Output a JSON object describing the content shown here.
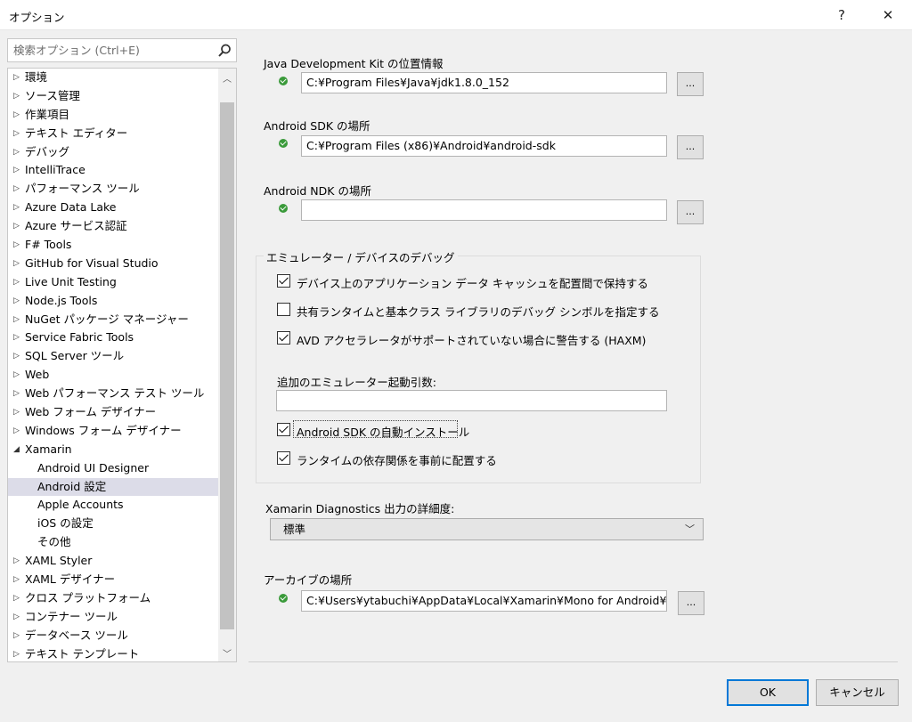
{
  "window": {
    "title": "オプション",
    "help_label": "?",
    "close_label": "✕"
  },
  "search": {
    "placeholder": "検索オプション (Ctrl+E)"
  },
  "tree": {
    "items": [
      {
        "label": "環境",
        "level": 0,
        "expanded": false
      },
      {
        "label": "ソース管理",
        "level": 0,
        "expanded": false
      },
      {
        "label": "作業項目",
        "level": 0,
        "expanded": false
      },
      {
        "label": "テキスト エディター",
        "level": 0,
        "expanded": false
      },
      {
        "label": "デバッグ",
        "level": 0,
        "expanded": false
      },
      {
        "label": "IntelliTrace",
        "level": 0,
        "expanded": false
      },
      {
        "label": "パフォーマンス ツール",
        "level": 0,
        "expanded": false
      },
      {
        "label": "Azure Data Lake",
        "level": 0,
        "expanded": false
      },
      {
        "label": "Azure サービス認証",
        "level": 0,
        "expanded": false
      },
      {
        "label": "F# Tools",
        "level": 0,
        "expanded": false
      },
      {
        "label": "GitHub for Visual Studio",
        "level": 0,
        "expanded": false
      },
      {
        "label": "Live Unit Testing",
        "level": 0,
        "expanded": false
      },
      {
        "label": "Node.js Tools",
        "level": 0,
        "expanded": false
      },
      {
        "label": "NuGet パッケージ マネージャー",
        "level": 0,
        "expanded": false
      },
      {
        "label": "Service Fabric Tools",
        "level": 0,
        "expanded": false
      },
      {
        "label": "SQL Server ツール",
        "level": 0,
        "expanded": false
      },
      {
        "label": "Web",
        "level": 0,
        "expanded": false
      },
      {
        "label": "Web パフォーマンス テスト ツール",
        "level": 0,
        "expanded": false
      },
      {
        "label": "Web フォーム デザイナー",
        "level": 0,
        "expanded": false
      },
      {
        "label": "Windows フォーム デザイナー",
        "level": 0,
        "expanded": false
      },
      {
        "label": "Xamarin",
        "level": 0,
        "expanded": true
      },
      {
        "label": "Android UI Designer",
        "level": 1
      },
      {
        "label": "Android 設定",
        "level": 1,
        "selected": true
      },
      {
        "label": "Apple Accounts",
        "level": 1
      },
      {
        "label": "iOS の設定",
        "level": 1
      },
      {
        "label": "その他",
        "level": 1
      },
      {
        "label": "XAML Styler",
        "level": 0,
        "expanded": false
      },
      {
        "label": "XAML デザイナー",
        "level": 0,
        "expanded": false
      },
      {
        "label": "クロス プラットフォーム",
        "level": 0,
        "expanded": false
      },
      {
        "label": "コンテナー ツール",
        "level": 0,
        "expanded": false
      },
      {
        "label": "データベース ツール",
        "level": 0,
        "expanded": false
      },
      {
        "label": "テキスト テンプレート",
        "level": 0,
        "expanded": false
      }
    ]
  },
  "settings": {
    "jdk": {
      "label": "Java Development Kit の位置情報",
      "value": "C:¥Program Files¥Java¥jdk1.8.0_152",
      "browse": "..."
    },
    "sdk": {
      "label": "Android SDK の場所",
      "value": "C:¥Program Files (x86)¥Android¥android-sdk",
      "browse": "..."
    },
    "ndk": {
      "label": "Android NDK の場所",
      "value": "",
      "browse": "..."
    },
    "emulator_group": {
      "title": "エミュレーター / デバイスのデバッグ",
      "cb_cache": {
        "label": "デバイス上のアプリケーション データ キャッシュを配置間で保持する",
        "checked": true
      },
      "cb_symbols": {
        "label": "共有ランタイムと基本クラス ライブラリのデバッグ シンボルを指定する",
        "checked": false
      },
      "cb_haxm": {
        "label": "AVD アクセラレータがサポートされていない場合に警告する (HAXM)",
        "checked": true
      },
      "args_label": "追加のエミュレーター起動引数:",
      "args_value": "",
      "cb_sdk_install": {
        "label": "Android SDK の自動インストール",
        "checked": true
      },
      "cb_runtime": {
        "label": "ランタイムの依存関係を事前に配置する",
        "checked": true
      }
    },
    "diagnostics": {
      "label": "Xamarin Diagnostics 出力の詳細度:",
      "value": "標準"
    },
    "archive": {
      "label": "アーカイブの場所",
      "value": "C:¥Users¥ytabuchi¥AppData¥Local¥Xamarin¥Mono for Android¥Arc",
      "browse": "..."
    }
  },
  "footer": {
    "ok_label": "OK",
    "cancel_label": "キャンセル"
  }
}
